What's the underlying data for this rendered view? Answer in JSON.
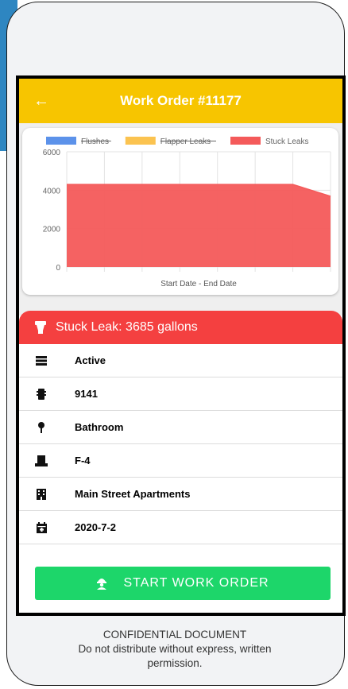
{
  "header": {
    "title": "Work Order #11177",
    "back_icon": "arrow-left-icon"
  },
  "chart_data": {
    "type": "area",
    "legend": [
      {
        "name": "Flushes",
        "color": "#4a86e8",
        "hidden": true
      },
      {
        "name": "Flapper Leaks",
        "color": "#fbbc3d",
        "hidden": true
      },
      {
        "name": "Stuck Leaks",
        "color": "#f45a5a",
        "hidden": false
      }
    ],
    "legend_position": "top",
    "xlabel": "Start Date - End Date",
    "ylabel": "",
    "ylim": [
      0,
      6000
    ],
    "yticks": [
      "6000",
      "4000",
      "2000",
      "0"
    ],
    "grid": true,
    "series": [
      {
        "name": "Stuck Leaks",
        "color": "#f45a5a",
        "x": [
          0,
          1,
          2,
          3,
          4,
          5,
          6,
          7
        ],
        "values": [
          4300,
          4300,
          4300,
          4300,
          4300,
          4300,
          4300,
          3685
        ]
      }
    ]
  },
  "leak_banner": {
    "text": "Stuck Leak: 3685 gallons",
    "color": "#f44040"
  },
  "details": [
    {
      "icon": "status-icon",
      "value": "Active"
    },
    {
      "icon": "device-icon",
      "value": "9141"
    },
    {
      "icon": "location-pin-icon",
      "value": "Bathroom"
    },
    {
      "icon": "toilet-icon",
      "value": "F-4"
    },
    {
      "icon": "building-icon",
      "value": "Main Street Apartments"
    },
    {
      "icon": "calendar-icon",
      "value": "2020-7-2"
    }
  ],
  "action": {
    "label": "START WORK ORDER",
    "icon": "worker-icon",
    "color": "#1dd66a"
  },
  "footer": {
    "line1": "CONFIDENTIAL DOCUMENT",
    "line2": "Do not distribute without express, written",
    "line3": "permission."
  }
}
